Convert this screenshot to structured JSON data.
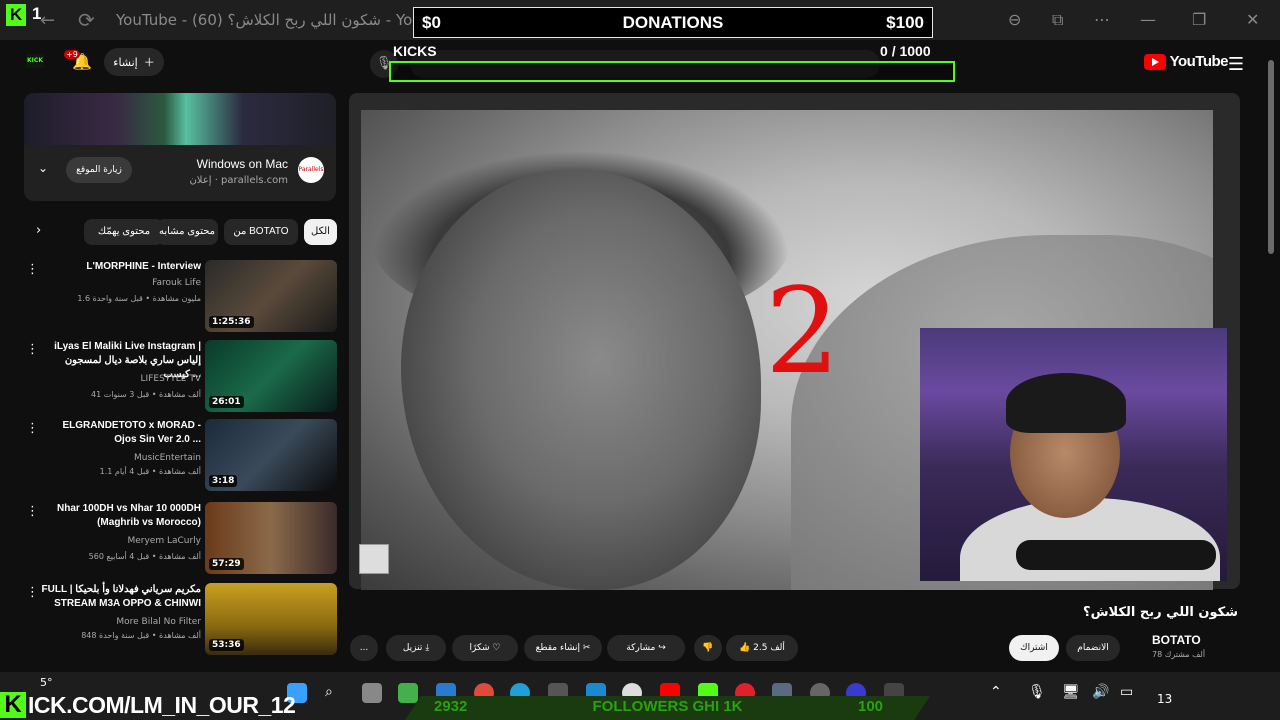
{
  "browser": {
    "tab_title": "YouTube - (60) شكون اللي ربح الكلاش؟ - YouTube"
  },
  "kick_overlay": {
    "logo": "K",
    "viewer_count": "1"
  },
  "donations_overlay": {
    "current": "$0",
    "label": "DONATIONS",
    "goal": "$100",
    "kicks_label": "KICKS",
    "kicks_current": "0",
    "kicks_goal": "/ 1000",
    "kicks_progress": 0
  },
  "yt_header": {
    "logo_text": "YouTube",
    "create_label": "إنشاء",
    "notification_badge": "+9",
    "avatar_label": "KICK"
  },
  "ad": {
    "title": "Windows on Mac",
    "sponsor": "إعلان · parallels.com",
    "visit_label": "زيارة الموقع",
    "logo": "Parallels"
  },
  "chips": [
    {
      "label": "الكل",
      "active": true
    },
    {
      "label": "من BOTATO",
      "active": false
    },
    {
      "label": "محتوى مشابه",
      "active": false
    },
    {
      "label": "محتوى يهمّك",
      "active": false
    }
  ],
  "related": [
    {
      "title": "L'MORPHINE - Interview",
      "channel": "Farouk Life",
      "meta": "1.6 مليون مشاهدة • قبل سنة واحدة",
      "duration": "1:25:36"
    },
    {
      "title": "iLyas El Maliki Live Instagram | إلياس ساري بلاصة ديال لمسجون كيسب ...",
      "channel": "LIFESTYLE TV",
      "meta": "41 ألف مشاهدة • قبل 3 سنوات",
      "duration": "26:01"
    },
    {
      "title": "ELGRANDETOTO x MORAD - Ojos Sin Ver 2.0 ...",
      "channel": "MusicEntertain",
      "meta": "1.1 ألف مشاهدة • قبل 4 أيام",
      "duration": "3:18"
    },
    {
      "title": "Nhar 100DH vs Nhar 10 000DH (Maghrib vs Morocco)",
      "channel": "Meryem LaCurly",
      "meta": "560 ألف مشاهدة • قبل 4 أسابيع",
      "duration": "57:29"
    },
    {
      "title": "FULL | مكريم سرياني فهدلانا وأ بلحيكا STREAM M3A OPPO & CHINWI",
      "channel": "More Bilal No Filter",
      "meta": "848 ألف مشاهدة • قبل سنة واحدة",
      "duration": "53:36"
    }
  ],
  "video": {
    "overlay_text": "2",
    "title": "شكون اللي ربح الكلاش؟",
    "channel": "BOTATO",
    "subs": "78 ألف مشترك",
    "subscribe_label": "اشتراك",
    "join_label": "الانضمام",
    "likes": "2.5 ألف",
    "share_label": "مشاركة",
    "clip_label": "إنشاء مقطع",
    "thanks_label": "شكرًا",
    "download_label": "تنزيل",
    "more_label": "..."
  },
  "bottom_overlay": {
    "kick_url_letter": "K",
    "kick_url": "ICK.COM/LM_IN_OUR_12",
    "followers_current": "2932",
    "followers_label": "FOLLOWERS GHI 1K",
    "followers_goal": "100"
  },
  "taskbar": {
    "weather": "5°",
    "clock": "13"
  },
  "colors": {
    "kick_green": "#53fc18",
    "yt_red": "#ff0000",
    "bg": "#0f0f0f"
  }
}
